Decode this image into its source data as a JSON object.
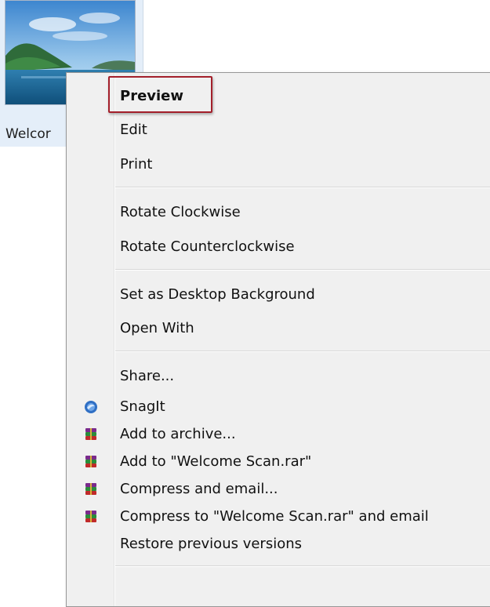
{
  "file": {
    "name": "Welcome Scan",
    "visible_name": "Welcor"
  },
  "context_menu": {
    "highlighted_item": "Preview",
    "items": [
      {
        "label": "Preview",
        "bold": true
      },
      {
        "label": "Edit"
      },
      {
        "label": "Print"
      },
      {
        "label": "Rotate Clockwise"
      },
      {
        "label": "Rotate Counterclockwise"
      },
      {
        "label": "Set as Desktop Background"
      },
      {
        "label": "Open With"
      },
      {
        "label": "Share..."
      },
      {
        "label": "SnagIt",
        "icon": "snagit-icon"
      },
      {
        "label": "Add to archive...",
        "icon": "winrar-icon"
      },
      {
        "label": "Add to \"Welcome Scan.rar\"",
        "icon": "winrar-icon"
      },
      {
        "label": "Compress and email...",
        "icon": "winrar-icon"
      },
      {
        "label": "Compress to \"Welcome Scan.rar\" and email",
        "icon": "winrar-icon"
      },
      {
        "label": "Restore previous versions"
      }
    ]
  },
  "colors": {
    "menu_background": "#f0f0f0",
    "highlight_border": "#a31f2a",
    "selection_background": "#e4eef9"
  }
}
